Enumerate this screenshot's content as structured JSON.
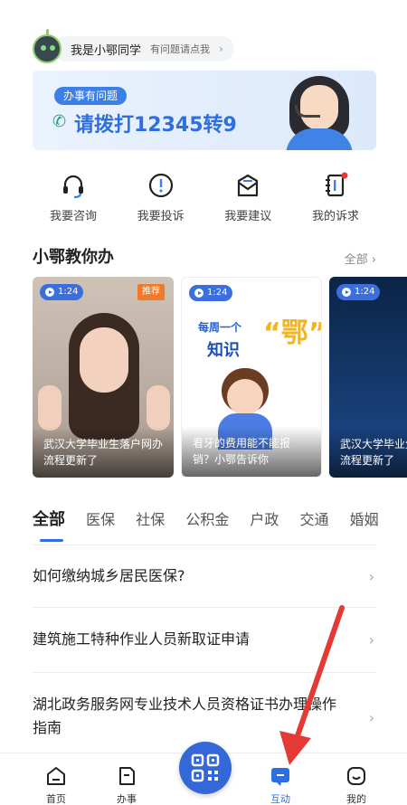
{
  "assistant": {
    "name": "我是小鄂同学",
    "hint": "有问题请点我",
    "arrow": "›"
  },
  "banner": {
    "tag": "办事有问题",
    "call_text": "请拨打12345转9",
    "phone_icon": "phone-icon"
  },
  "actions": [
    {
      "label": "我要咨询",
      "icon": "headset-icon"
    },
    {
      "label": "我要投诉",
      "icon": "alert-circle-icon"
    },
    {
      "label": "我要建议",
      "icon": "envelope-icon"
    },
    {
      "label": "我的诉求",
      "icon": "notebook-icon"
    }
  ],
  "section": {
    "title": "小鄂教你办",
    "more": "全部 ›"
  },
  "cards": [
    {
      "duration": "1:24",
      "tag": "推荐",
      "caption": "武汉大学毕业生落户网办流程更新了"
    },
    {
      "duration": "1:24",
      "caption": "看牙的费用能不能报销？小鄂告诉你",
      "art_line1": "每周一个",
      "art_line2": "知识",
      "art_line3": "“鄂”"
    },
    {
      "duration": "1:24",
      "caption": "武汉大学毕业生落户网办流程更新了"
    }
  ],
  "tabs": [
    "全部",
    "医保",
    "社保",
    "公积金",
    "户政",
    "交通",
    "婚姻"
  ],
  "active_tab": "全部",
  "list": [
    "如何缴纳城乡居民医保?",
    "建筑施工特种作业人员新取证申请",
    "湖北政务服务网专业技术人员资格证书办理操作指南"
  ],
  "nav": [
    {
      "label": "首页",
      "icon": "home-icon"
    },
    {
      "label": "办事",
      "icon": "document-icon"
    },
    {
      "label": "互动",
      "icon": "chat-icon",
      "active": true
    },
    {
      "label": "我的",
      "icon": "smile-icon"
    }
  ],
  "scan_icon": "qr-scan-icon",
  "colors": {
    "primary": "#2f6ee2",
    "accent_orange": "#f07a2c",
    "annotation_red": "#e53935",
    "call_green": "#1aa37a"
  }
}
